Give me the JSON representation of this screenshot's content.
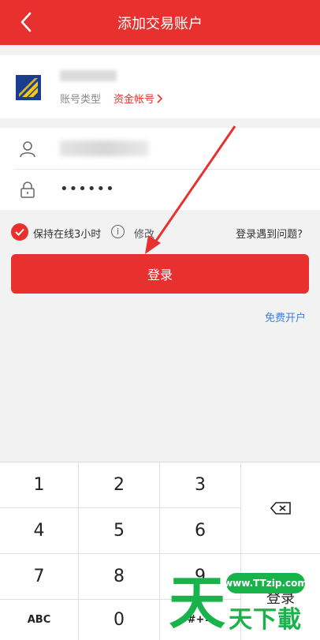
{
  "header": {
    "title": "添加交易账户"
  },
  "broker": {
    "account_type_label": "账号类型",
    "account_type_value": "资金帐号"
  },
  "form": {
    "password_value": "••••••"
  },
  "options": {
    "keep_online_label": "保持在线3小时",
    "info_symbol": "i",
    "modify_label": "修改",
    "trouble_link": "登录遇到问题?"
  },
  "login_button": "登录",
  "open_account_link": "免费开户",
  "keyboard": {
    "keys": [
      "1",
      "2",
      "3",
      "4",
      "5",
      "6",
      "7",
      "8",
      "9",
      "ABC",
      "0",
      "#+="
    ],
    "submit_label": "登录"
  },
  "watermark": {
    "pill_text": "www.TTzip.com",
    "big_char": "天",
    "text": "天下載"
  },
  "colors": {
    "brand_red": "#e8302f",
    "link_blue": "#3a7ee6",
    "watermark_green": "#18b34a"
  }
}
